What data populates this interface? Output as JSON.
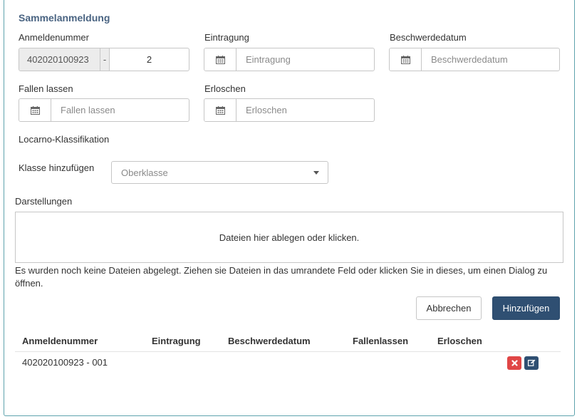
{
  "form": {
    "title": "Sammelanmeldung",
    "anmeldenummer": {
      "label": "Anmeldenummer",
      "prefix": "402020100923",
      "separator": "-",
      "suffix": "2"
    },
    "eintragung": {
      "label": "Eintragung",
      "placeholder": "Eintragung"
    },
    "beschwerdedatum": {
      "label": "Beschwerdedatum",
      "placeholder": "Beschwerdedatum"
    },
    "fallen_lassen": {
      "label": "Fallen lassen",
      "placeholder": "Fallen lassen"
    },
    "erloschen": {
      "label": "Erloschen",
      "placeholder": "Erloschen"
    },
    "locarno_label": "Locarno-Klassifikation",
    "klasse": {
      "label": "Klasse hinzufügen",
      "selected": "Oberklasse"
    },
    "darstellungen": {
      "label": "Darstellungen",
      "dropzone_text": "Dateien hier ablegen oder klicken.",
      "help_text": "Es wurden noch keine Dateien abgelegt. Ziehen sie Dateien in das umrandete Feld oder klicken Sie in dieses, um einen Dialog zu öffnen."
    },
    "buttons": {
      "cancel": "Abbrechen",
      "add": "Hinzufügen"
    }
  },
  "table": {
    "columns": [
      "Anmeldenummer",
      "Eintragung",
      "Beschwerdedatum",
      "Fallenlassen",
      "Erloschen"
    ],
    "rows": [
      {
        "anmeldenummer": "402020100923 - 001",
        "eintragung": "",
        "beschwerdedatum": "",
        "fallenlassen": "",
        "erloschen": ""
      }
    ]
  },
  "icons": {
    "calendar": "calendar-icon",
    "dropdown": "chevron-down-icon",
    "delete": "close-icon",
    "edit": "edit-icon"
  },
  "colors": {
    "accent": "#2f4f72",
    "danger": "#e04646",
    "border_frame": "#5ea3ad",
    "title": "#4a6482"
  }
}
